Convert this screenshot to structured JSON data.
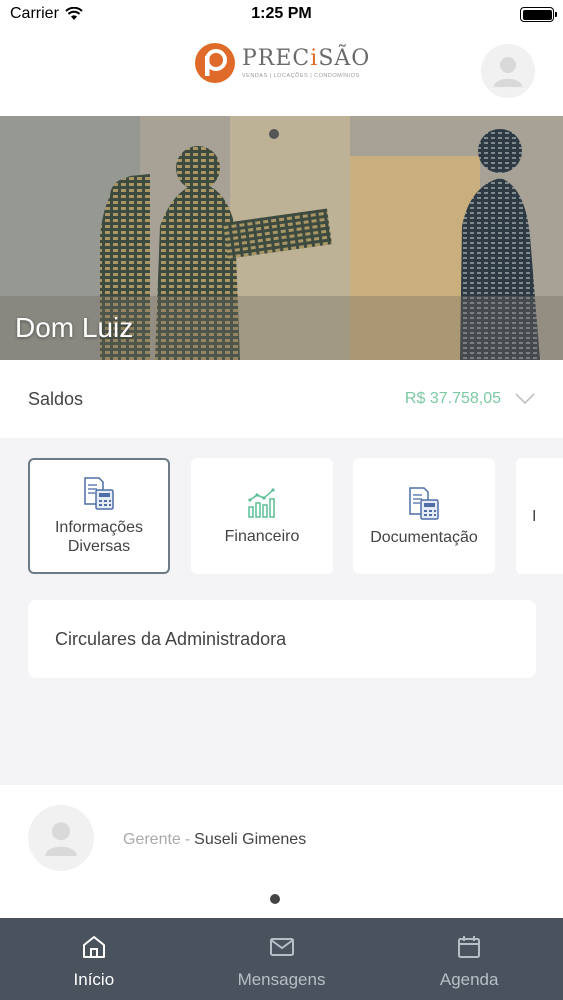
{
  "status_bar": {
    "carrier": "Carrier",
    "time": "1:25 PM"
  },
  "header": {
    "logo_name_pre": "PREC",
    "logo_name_hl": "i",
    "logo_name_post": "SÃO",
    "logo_tagline": "VENDAS | LOCAÇÕES | CONDOMÍNIOS"
  },
  "banner": {
    "title": "Dom Luiz"
  },
  "saldos": {
    "label": "Saldos",
    "value": "R$ 37.758,05",
    "value_color": "#7cc9a3"
  },
  "cards": [
    {
      "label": "Informações Diversas",
      "icon": "document-calculator-icon",
      "selected": true
    },
    {
      "label": "Financeiro",
      "icon": "bar-chart-icon",
      "selected": false
    },
    {
      "label": "Documentação",
      "icon": "document-calculator-icon",
      "selected": false
    },
    {
      "label": "I",
      "icon": "",
      "selected": false
    }
  ],
  "circulares": {
    "label": "Circulares da Administradora"
  },
  "manager": {
    "role": "Gerente",
    "separator": "-",
    "name": "Suseli Gimenes"
  },
  "tabbar": {
    "items": [
      {
        "label": "Início",
        "icon": "home-icon",
        "active": true
      },
      {
        "label": "Mensagens",
        "icon": "mail-icon",
        "active": false
      },
      {
        "label": "Agenda",
        "icon": "calendar-icon",
        "active": false
      }
    ]
  },
  "colors": {
    "accent_green": "#7cc9a3",
    "logo_orange": "#e06a2a",
    "tabbar_bg": "#4a525e",
    "icon_blue": "#4f6ea8"
  }
}
